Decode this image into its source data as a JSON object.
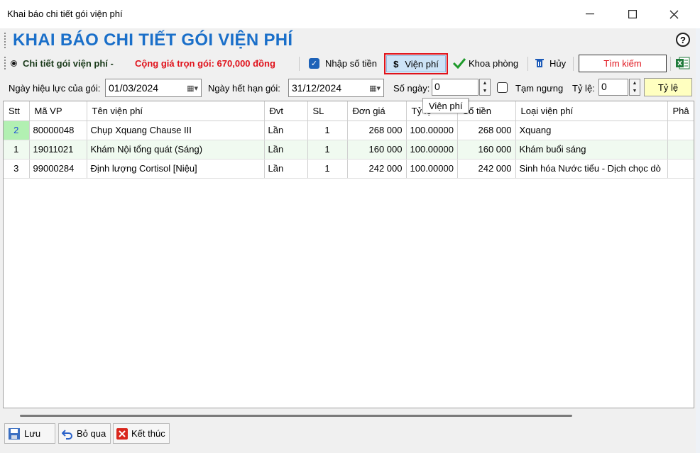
{
  "window": {
    "title": "Khai báo chi tiết gói viện phí"
  },
  "page_title": "KHAI BÁO CHI TIẾT GÓI VIỆN PHÍ",
  "toolbar": {
    "section_label": "Chi tiết gói viện phí -",
    "total_text": "Cộng giá trọn gói: 670,000 đồng",
    "enter_amount_label": "Nhập số tiền",
    "vien_phi_label": "Viện phí",
    "khoa_phong_label": "Khoa phòng",
    "huy_label": "Hủy",
    "search_label": "Tìm kiếm"
  },
  "filter": {
    "effective_label": "Ngày hiệu lực của gói:",
    "effective_date": "01/03/2024",
    "expiry_label": "Ngày hết hạn gói:",
    "expiry_date": "31/12/2024",
    "days_label": "Số ngày:",
    "days_value": "0",
    "pause_label": "Tạm ngưng",
    "ratio_label": "Tỷ lệ:",
    "ratio_value": "0",
    "ratio_button": "Tỷ lệ"
  },
  "tooltip": "Viện phí",
  "grid": {
    "columns": [
      "Stt",
      "Mã VP",
      "Tên viện phí",
      "Đvt",
      "SL",
      "Đơn giá",
      "Tỷ lệ",
      "Số tiền",
      "Loại viện phí",
      "Phâ"
    ],
    "rows": [
      [
        "2",
        "80000048",
        "Chụp Xquang Chause III",
        "Lần",
        "1",
        "268 000",
        "100.00000",
        "268 000",
        "Xquang",
        ""
      ],
      [
        "1",
        "19011021",
        "Khám Nội tổng quát (Sáng)",
        "Lần",
        "1",
        "160 000",
        "100.00000",
        "160 000",
        "Khám buổi sáng",
        ""
      ],
      [
        "3",
        "99000284",
        "Định lượng Cortisol [Niệu]",
        "Lần",
        "1",
        "242 000",
        "100.00000",
        "242 000",
        "Sinh hóa Nước tiểu - Dịch chọc dò",
        ""
      ]
    ]
  },
  "buttons": {
    "save": "Lưu",
    "skip": "Bỏ qua",
    "finish": "Kết thúc"
  },
  "colors": {
    "title_blue": "#1a6fc9",
    "red_text": "#e0121b",
    "row_alt": "#f0faf0"
  }
}
